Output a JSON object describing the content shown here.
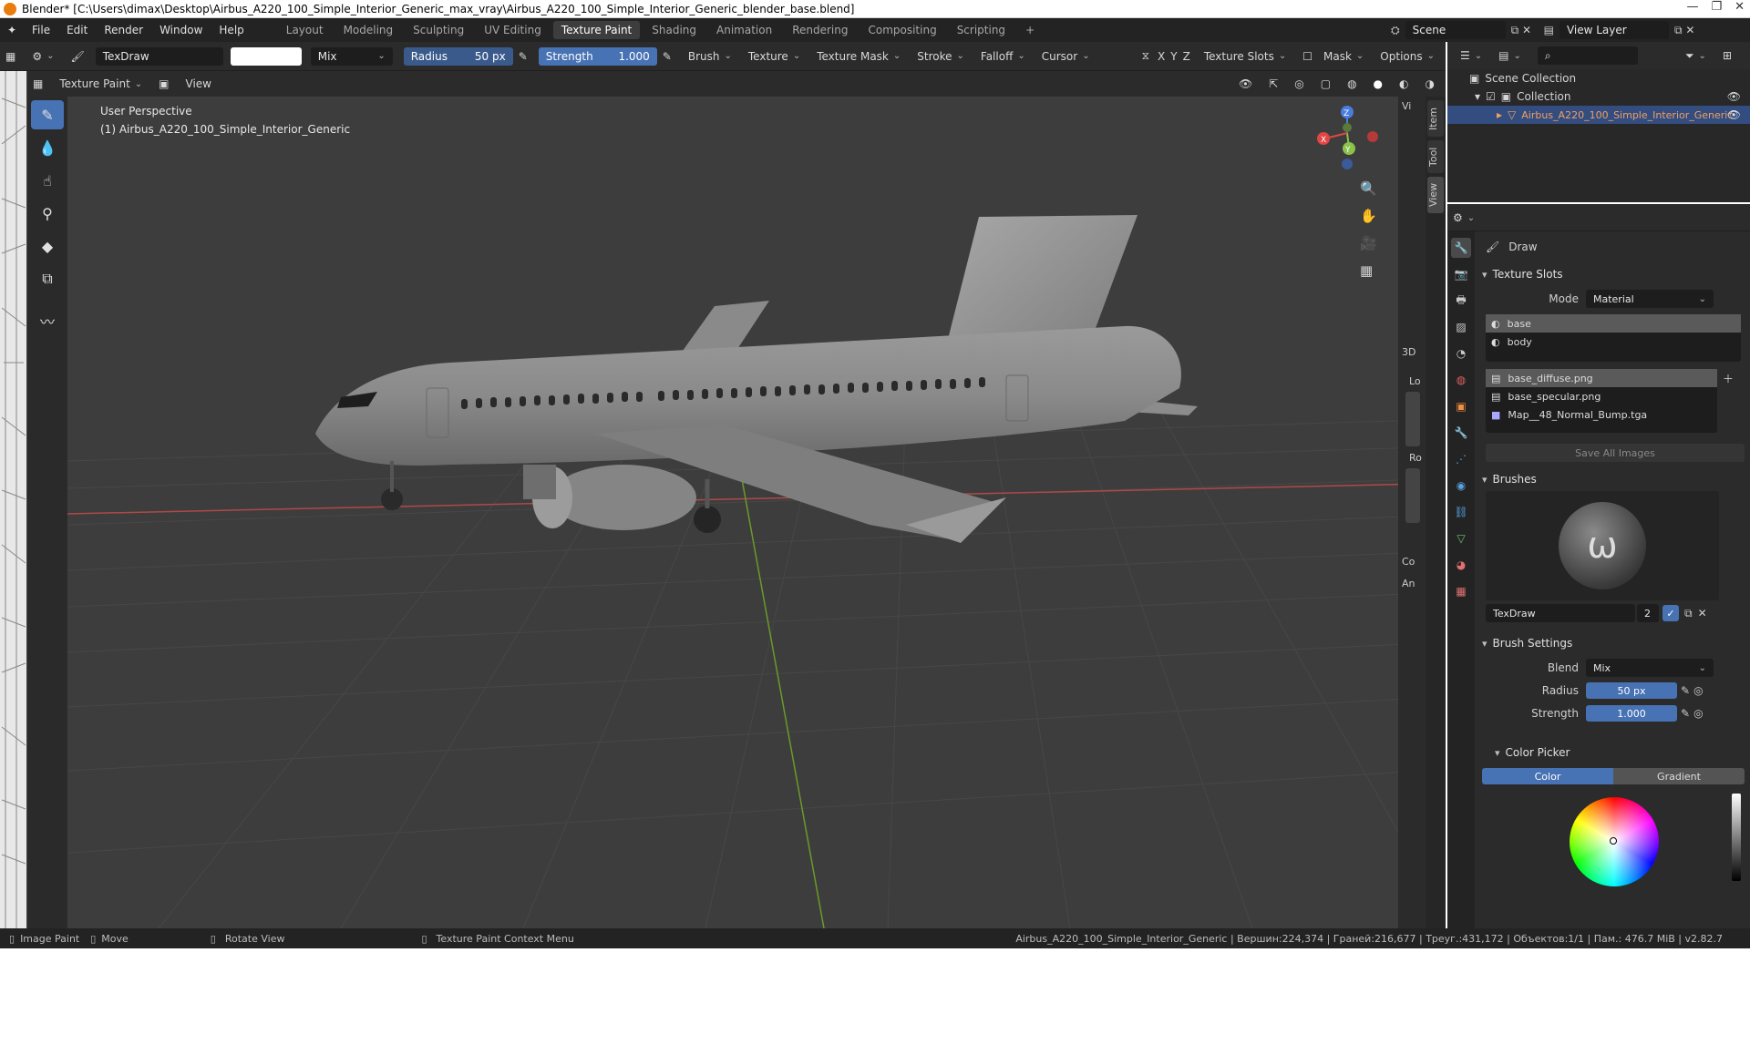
{
  "window": {
    "title": "Blender* [C:\\Users\\dimax\\Desktop\\Airbus_A220_100_Simple_Interior_Generic_max_vray\\Airbus_A220_100_Simple_Interior_Generic_blender_base.blend]"
  },
  "menu": [
    "File",
    "Edit",
    "Render",
    "Window",
    "Help"
  ],
  "workspaces": [
    "Layout",
    "Modeling",
    "Sculpting",
    "UV Editing",
    "Texture Paint",
    "Shading",
    "Animation",
    "Rendering",
    "Compositing",
    "Scripting",
    "+"
  ],
  "active_workspace": "Texture Paint",
  "scene": {
    "label": "Scene",
    "view_layer": "View Layer"
  },
  "toolheader": {
    "brush_name": "TexDraw",
    "blend": "Mix",
    "radius_label": "Radius",
    "radius_value": "50 px",
    "strength_label": "Strength",
    "strength_value": "1.000",
    "dropdowns": [
      "Brush",
      "Texture",
      "Texture Mask",
      "Stroke",
      "Falloff",
      "Cursor"
    ],
    "axes": [
      "X",
      "Y",
      "Z"
    ],
    "texture_slots": "Texture Slots",
    "mask": "Mask",
    "options": "Options"
  },
  "header2": {
    "mode": "Texture Paint",
    "view": "View"
  },
  "viewport": {
    "perspective": "User Perspective",
    "object": "(1) Airbus_A220_100_Simple_Interior_Generic",
    "side_labels": [
      "Vi",
      "3D",
      "Lo",
      "Ro",
      "Co",
      "An"
    ],
    "ntabs": [
      "Item",
      "Tool",
      "View"
    ]
  },
  "outliner": {
    "scene_collection": "Scene Collection",
    "collection": "Collection",
    "object": "Airbus_A220_100_Simple_Interior_Generic"
  },
  "properties": {
    "tool": "Draw",
    "texture_slots": {
      "title": "Texture Slots",
      "mode_label": "Mode",
      "mode": "Material",
      "materials": [
        "base",
        "body"
      ],
      "images": [
        "base_diffuse.png",
        "base_specular.png",
        "Map__48_Normal_Bump.tga"
      ],
      "save_all": "Save All Images"
    },
    "brushes": {
      "title": "Brushes",
      "name": "TexDraw",
      "users": "2"
    },
    "brush_settings": {
      "title": "Brush Settings",
      "blend_label": "Blend",
      "blend": "Mix",
      "radius_label": "Radius",
      "radius": "50 px",
      "strength_label": "Strength",
      "strength": "1.000"
    },
    "color_picker": {
      "title": "Color Picker",
      "tab_color": "Color",
      "tab_gradient": "Gradient"
    }
  },
  "statusbar": {
    "image_paint": "Image Paint",
    "move": "Move",
    "rotate": "Rotate View",
    "context": "Texture Paint Context Menu",
    "stats": "Airbus_A220_100_Simple_Interior_Generic | Вершин:224,374 | Граней:216,677 | Треуг.:431,172 | Объектов:1/1 | Пам.: 476.7 MiB | v2.82.7"
  },
  "colors": {
    "accent": "#4772b3",
    "selection": "#334d80",
    "object_name": "#f0a060"
  }
}
